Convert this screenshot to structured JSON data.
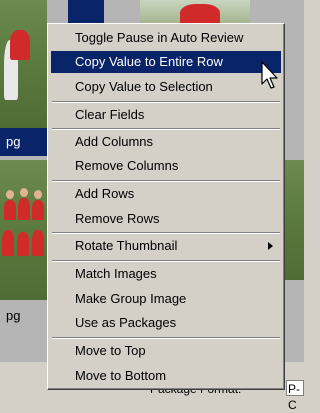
{
  "thumbnails": {
    "captions": [
      "pg",
      "pg"
    ]
  },
  "context_menu": {
    "items": [
      {
        "label": "Toggle Pause in Auto Review"
      },
      {
        "label": "Copy Value to Entire Row",
        "highlighted": true
      },
      {
        "label": "Copy Value to Selection"
      },
      {
        "label": "Clear Fields"
      },
      {
        "label": "Add Columns"
      },
      {
        "label": "Remove Columns"
      },
      {
        "label": "Add Rows"
      },
      {
        "label": "Remove Rows"
      },
      {
        "label": "Rotate Thumbnail",
        "has_submenu": true
      },
      {
        "label": "Match Images"
      },
      {
        "label": "Make Group Image"
      },
      {
        "label": "Use as Packages"
      },
      {
        "label": "Move to Top"
      },
      {
        "label": "Move to Bottom"
      }
    ]
  },
  "footer": {
    "field_label": "Package Format:",
    "field_value": "P-C"
  },
  "colors": {
    "highlight": "#0a246a",
    "menu_bg": "#d4d0c8"
  }
}
